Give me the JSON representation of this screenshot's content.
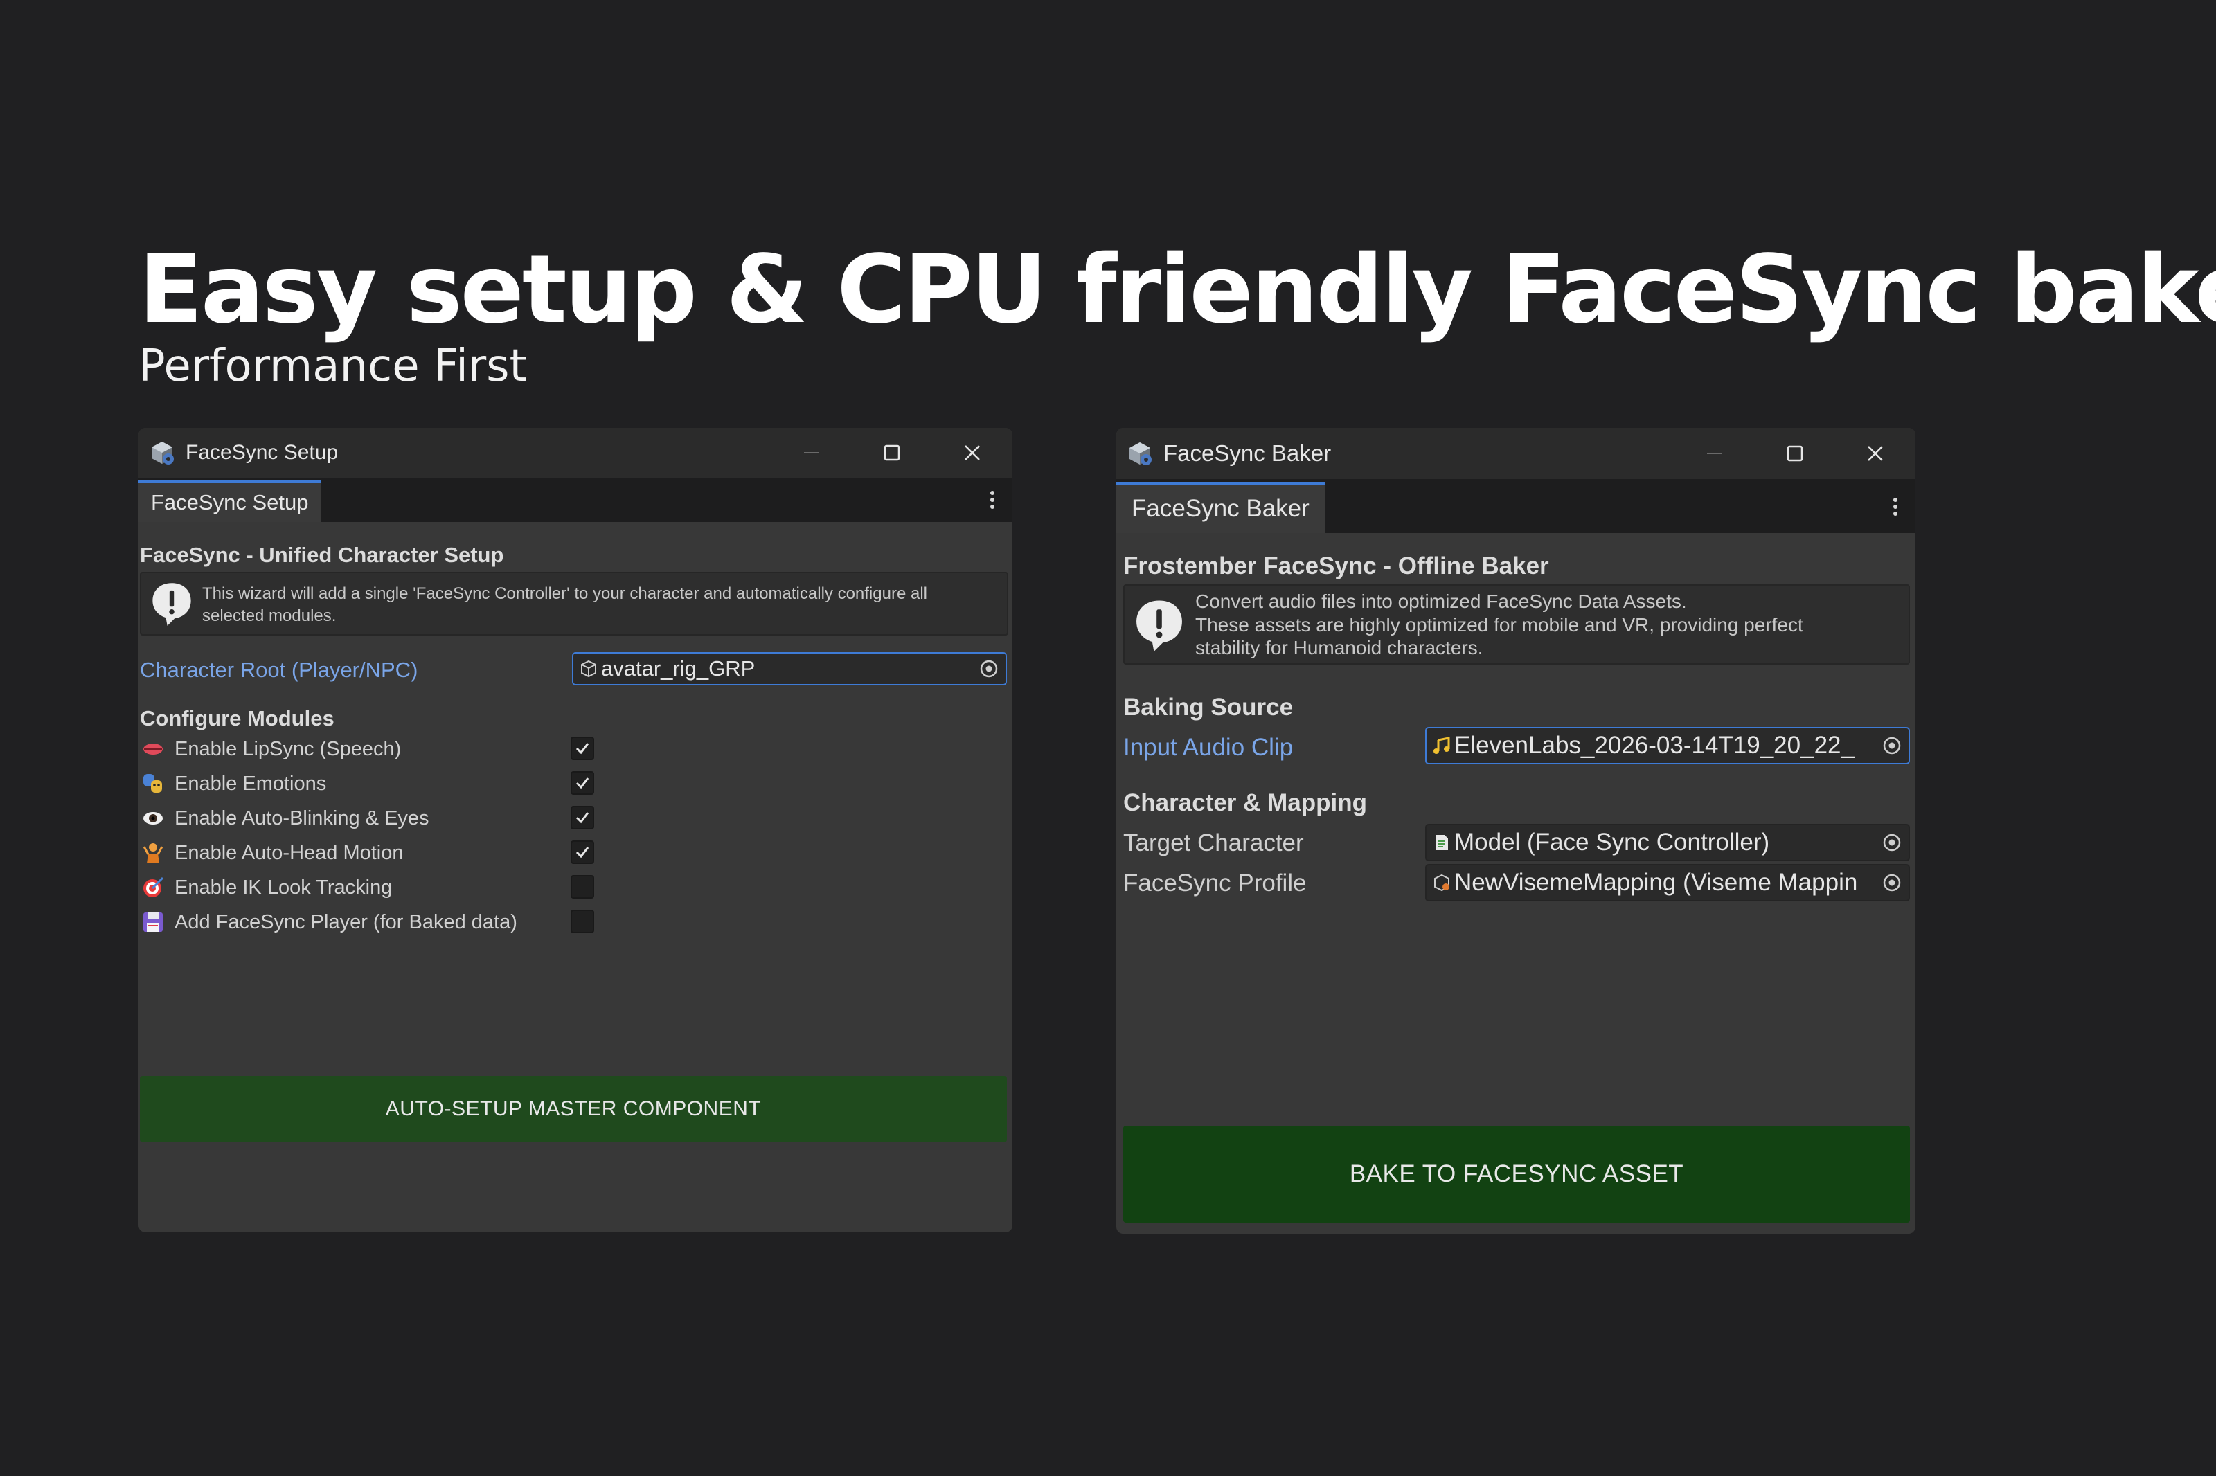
{
  "headline": "Easy setup & CPU friendly FaceSync bake",
  "subheadline": "Performance First",
  "setup_window": {
    "title": "FaceSync Setup",
    "tab_label": "FaceSync Setup",
    "section_title": "FaceSync - Unified Character Setup",
    "help_lines": [
      "This wizard will add a single 'FaceSync Controller' to your character and automatically configure all",
      "selected modules."
    ],
    "character_root_label": "Character Root (Player/NPC)",
    "character_root_value": "avatar_rig_GRP",
    "modules_title": "Configure Modules",
    "modules": [
      {
        "label": "Enable LipSync (Speech)",
        "icon": "lips-icon",
        "checked": true
      },
      {
        "label": "Enable Emotions",
        "icon": "theater-masks-icon",
        "checked": true
      },
      {
        "label": "Enable Auto-Blinking & Eyes",
        "icon": "eye-icon",
        "checked": true
      },
      {
        "label": "Enable Auto-Head Motion",
        "icon": "person-icon",
        "checked": true
      },
      {
        "label": "Enable IK Look Tracking",
        "icon": "target-icon",
        "checked": false
      },
      {
        "label": "Add FaceSync Player (for Baked data)",
        "icon": "floppy-disk-icon",
        "checked": false
      }
    ],
    "action_button": "AUTO-SETUP MASTER COMPONENT"
  },
  "baker_window": {
    "title": "FaceSync Baker",
    "tab_label": "FaceSync Baker",
    "section_title": "Frostember FaceSync - Offline Baker",
    "help_lines": [
      "Convert audio files into optimized FaceSync Data Assets.",
      "These assets are highly optimized for mobile and VR, providing perfect",
      "stability for Humanoid characters."
    ],
    "baking_source_title": "Baking Source",
    "input_audio_label": "Input Audio Clip",
    "input_audio_value": "ElevenLabs_2026-03-14T19_20_22_",
    "mapping_title": "Character & Mapping",
    "target_character_label": "Target Character",
    "target_character_value": "Model (Face Sync Controller)",
    "profile_label": "FaceSync Profile",
    "profile_value": "NewVisemeMapping (Viseme Mappin",
    "action_button": "BAKE TO FACESYNC ASSET"
  },
  "colors": {
    "background": "#202022",
    "window": "#383838",
    "titlebar": "#2b2b2b",
    "link": "#7aa5e8",
    "focus": "#3e7bd6",
    "button_green": "#1f4a1d"
  }
}
